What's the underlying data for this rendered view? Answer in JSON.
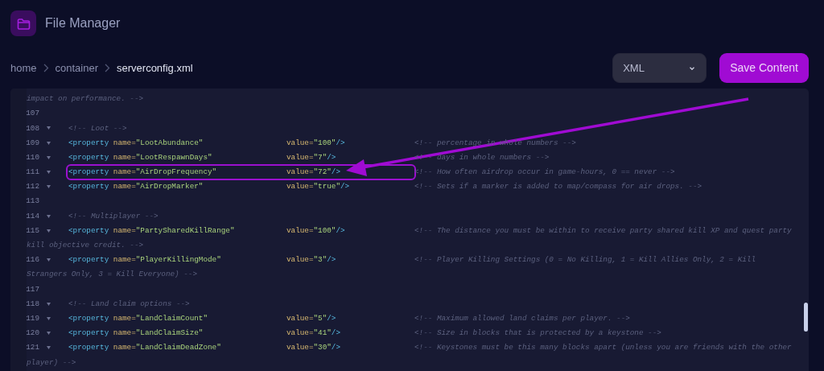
{
  "header": {
    "title": "File Manager"
  },
  "breadcrumb": [
    {
      "label": "home",
      "current": false
    },
    {
      "label": "container",
      "current": false
    },
    {
      "label": "serverconfig.xml",
      "current": true
    }
  ],
  "format_select": {
    "value": "XML"
  },
  "save_button": {
    "label": "Save Content"
  },
  "editor": {
    "lines": [
      {
        "kind": "continuation",
        "text": "impact on performance. -->"
      },
      {
        "kind": "blank",
        "number": "107",
        "fold": false
      },
      {
        "kind": "comment",
        "number": "108",
        "fold": true,
        "text": "<!-- Loot -->"
      },
      {
        "kind": "property",
        "number": "109",
        "fold": true,
        "code": "<property name=\"LootAbundance\"",
        "value": "value=\"100\"/>",
        "comment": "<!-- percentage in whole numbers -->",
        "highlighted": false
      },
      {
        "kind": "property",
        "number": "110",
        "fold": true,
        "code": "<property name=\"LootRespawnDays\"",
        "value": "value=\"7\"/>",
        "comment": "<!-- days in whole numbers -->",
        "highlighted": false
      },
      {
        "kind": "property",
        "number": "111",
        "fold": true,
        "code": "<property name=\"AirDropFrequency\"",
        "value": "value=\"72\"/>",
        "comment": "<!-- How often airdrop occur in game-hours, 0 == never -->",
        "highlighted": true
      },
      {
        "kind": "property",
        "number": "112",
        "fold": true,
        "code": "<property name=\"AirDropMarker\"",
        "value": "value=\"true\"/>",
        "comment": "<!-- Sets if a marker is added to map/compass for air drops. -->",
        "highlighted": false
      },
      {
        "kind": "blank",
        "number": "113",
        "fold": false
      },
      {
        "kind": "comment",
        "number": "114",
        "fold": true,
        "text": "<!-- Multiplayer -->"
      },
      {
        "kind": "property",
        "number": "115",
        "fold": true,
        "code": "<property name=\"PartySharedKillRange\"",
        "value": "value=\"100\"/>",
        "comment": "<!-- The distance you must be within to receive party shared kill XP and quest party",
        "highlighted": false
      },
      {
        "kind": "continuation",
        "text": "kill objective credit. -->"
      },
      {
        "kind": "property",
        "number": "116",
        "fold": true,
        "code": "<property name=\"PlayerKillingMode\"",
        "value": "value=\"3\"/>",
        "comment": "<!-- Player Killing Settings (0 = No Killing, 1 = Kill Allies Only, 2 = Kill",
        "highlighted": false
      },
      {
        "kind": "continuation",
        "text": "Strangers Only, 3 = Kill Everyone) -->"
      },
      {
        "kind": "blank",
        "number": "117",
        "fold": false
      },
      {
        "kind": "comment",
        "number": "118",
        "fold": true,
        "text": "<!-- Land claim options -->"
      },
      {
        "kind": "property",
        "number": "119",
        "fold": true,
        "code": "<property name=\"LandClaimCount\"",
        "value": "value=\"5\"/>",
        "comment": "<!-- Maximum allowed land claims per player. -->",
        "highlighted": false
      },
      {
        "kind": "property",
        "number": "120",
        "fold": true,
        "code": "<property name=\"LandClaimSize\"",
        "value": "value=\"41\"/>",
        "comment": "<!-- Size in blocks that is protected by a keystone -->",
        "highlighted": false
      },
      {
        "kind": "property",
        "number": "121",
        "fold": true,
        "code": "<property name=\"LandClaimDeadZone\"",
        "value": "value=\"30\"/>",
        "comment": "<!-- Keystones must be this many blocks apart (unless you are friends with the other",
        "highlighted": false
      },
      {
        "kind": "continuation",
        "text": "player) -->"
      }
    ]
  }
}
